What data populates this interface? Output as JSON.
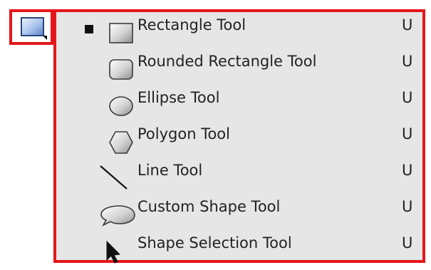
{
  "tool_button": {
    "icon": "rectangle-shape-icon"
  },
  "menu": {
    "items": [
      {
        "label": "Rectangle Tool",
        "shortcut": "U",
        "icon": "rectangle-icon",
        "selected": true
      },
      {
        "label": "Rounded Rectangle Tool",
        "shortcut": "U",
        "icon": "rounded-rectangle-icon",
        "selected": false
      },
      {
        "label": "Ellipse Tool",
        "shortcut": "U",
        "icon": "ellipse-icon",
        "selected": false
      },
      {
        "label": "Polygon Tool",
        "shortcut": "U",
        "icon": "polygon-icon",
        "selected": false
      },
      {
        "label": "Line Tool",
        "shortcut": "U",
        "icon": "line-icon",
        "selected": false
      },
      {
        "label": "Custom Shape Tool",
        "shortcut": "U",
        "icon": "custom-shape-icon",
        "selected": false
      },
      {
        "label": "Shape Selection Tool",
        "shortcut": "U",
        "icon": "arrow-cursor-icon",
        "selected": false
      }
    ]
  },
  "colors": {
    "highlight_border": "#e5161b",
    "menu_background": "#e6e6e6"
  }
}
